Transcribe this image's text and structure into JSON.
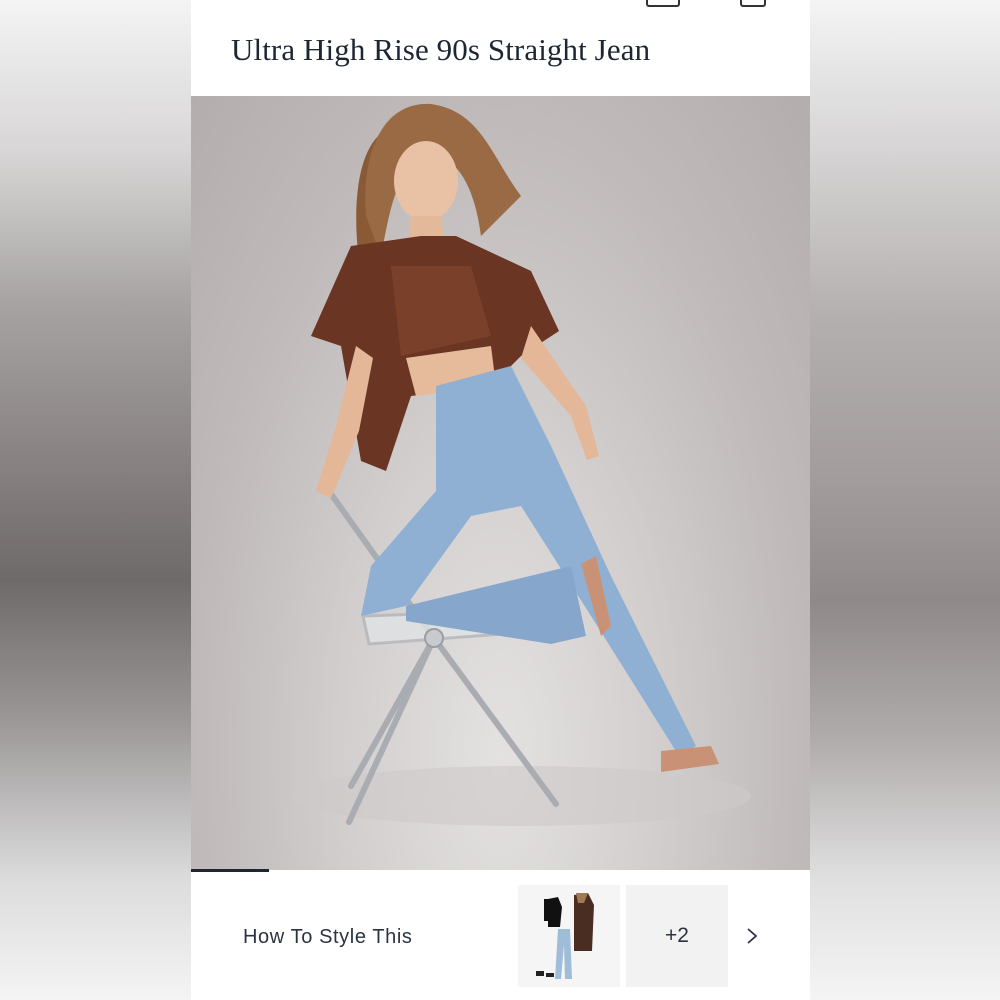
{
  "product": {
    "title": "Ultra High Rise 90s Straight Jean"
  },
  "gallery": {
    "image_alt": "Model wearing brown satin top and light-wash straight jeans posed on a clear folding chair",
    "progress": 0.125
  },
  "style_section": {
    "label": "How To Style This",
    "more_count": "+2",
    "next_icon": "chevron-right-icon"
  },
  "colors": {
    "title_text": "#1d2733",
    "progress": "#1d2733"
  }
}
